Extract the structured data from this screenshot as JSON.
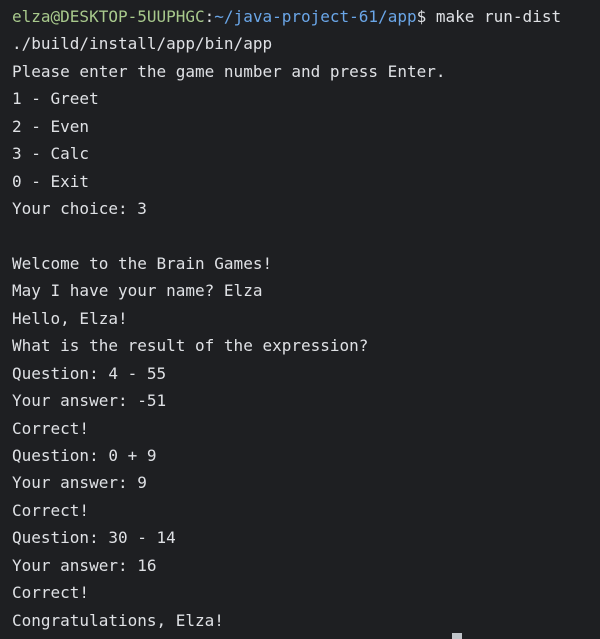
{
  "prompt": {
    "user_host": "elza@DESKTOP-5UUPHGC",
    "separator": ":",
    "path": "~/java-project-61/app",
    "symbol": "$ ",
    "command": "make run-dist"
  },
  "output": [
    "./build/install/app/bin/app",
    "Please enter the game number and press Enter.",
    "1 - Greet",
    "2 - Even",
    "3 - Calc",
    "0 - Exit",
    "Your choice: 3",
    "",
    "Welcome to the Brain Games!",
    "May I have your name? Elza",
    "Hello, Elza!",
    "What is the result of the expression?",
    "Question: 4 - 55",
    "Your answer: -51",
    "Correct!",
    "Question: 0 + 9",
    "Your answer: 9",
    "Correct!",
    "Question: 30 - 14",
    "Your answer: 16",
    "Correct!",
    "Congratulations, Elza!"
  ]
}
